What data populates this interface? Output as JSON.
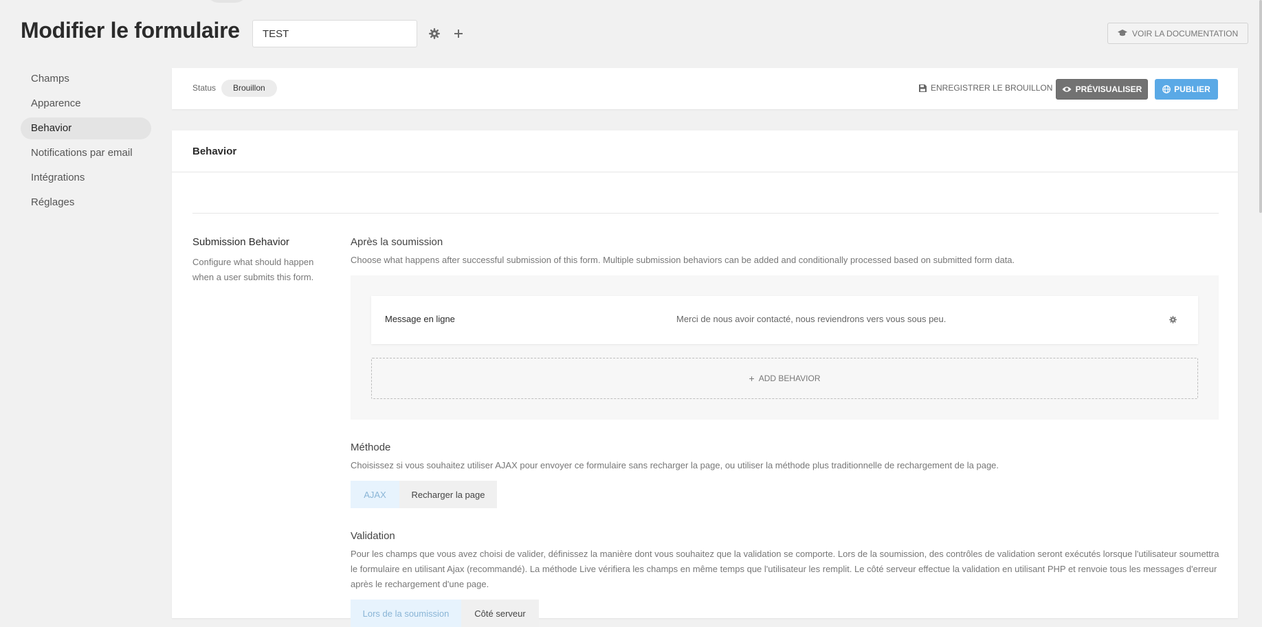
{
  "header": {
    "title": "Modifier le formulaire",
    "form_name": "TEST",
    "doc_button": "VOIR LA DOCUMENTATION"
  },
  "sidebar": {
    "items": [
      {
        "label": "Champs"
      },
      {
        "label": "Apparence"
      },
      {
        "label": "Behavior"
      },
      {
        "label": "Notifications par email"
      },
      {
        "label": "Intégrations"
      },
      {
        "label": "Réglages"
      }
    ],
    "active": "Behavior"
  },
  "status_bar": {
    "status_label": "Status",
    "status_value": "Brouillon",
    "save_draft": "ENREGISTRER LE BROUILLON",
    "preview": "PRÉVISUALISER",
    "publish": "PUBLIER"
  },
  "main": {
    "card_title": "Behavior",
    "section_title": "Submission Behavior",
    "section_desc": "Configure what should happen when a user submits this form.",
    "after_submit": {
      "title": "Après la soumission",
      "desc": "Choose what happens after successful submission of this form. Multiple submission behaviors can be added and conditionally processed based on submitted form data.",
      "behaviors": [
        {
          "type": "Message en ligne",
          "message": "Merci de nous avoir contacté, nous reviendrons vers vous sous peu."
        }
      ],
      "add_label": "ADD BEHAVIOR"
    },
    "method": {
      "title": "Méthode",
      "desc": "Choisissez si vous souhaitez utiliser AJAX pour envoyer ce formulaire sans recharger la page, ou utiliser la méthode plus traditionnelle de rechargement de la page.",
      "options": [
        "AJAX",
        "Recharger la page"
      ],
      "selected": "AJAX"
    },
    "validation": {
      "title": "Validation",
      "desc": "Pour les champs que vous avez choisi de valider, définissez la manière dont vous souhaitez que la validation se comporte. Lors de la soumission, des contrôles de validation seront exécutés lorsque l'utilisateur soumettra le formulaire en utilisant Ajax (recommandé). La méthode Live vérifiera les champs en même temps que l'utilisateur les remplit. Le côté serveur effectue la validation en utilisant PHP et renvoie tous les messages d'erreur après le rechargement d'une page.",
      "options": [
        "Lors de la soumission",
        "Côté serveur"
      ],
      "selected": "Lors de la soumission"
    }
  },
  "colors": {
    "accent": "#5aa9e6",
    "background": "#f1f1f1",
    "preview_button": "#727272"
  }
}
